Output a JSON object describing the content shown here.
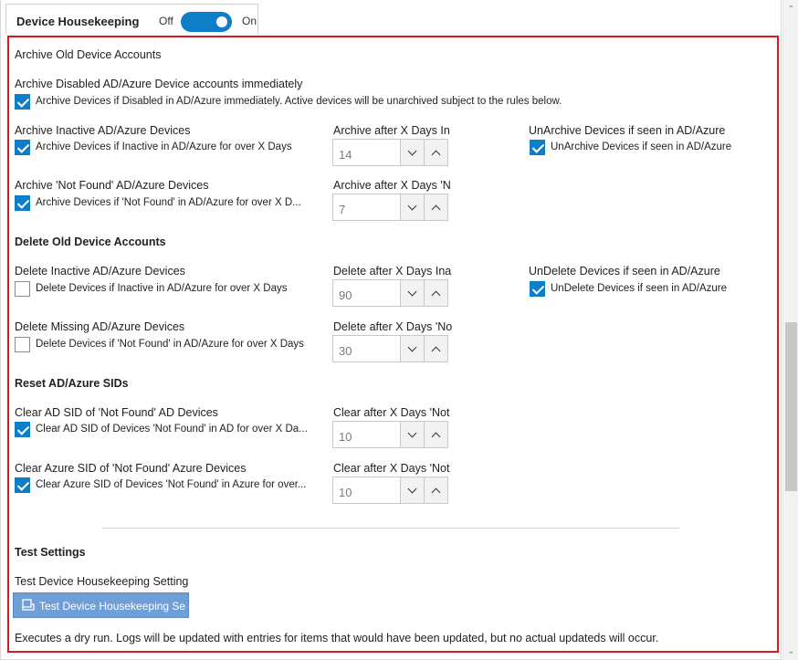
{
  "header": {
    "title": "Device Housekeeping",
    "toggle_off": "Off",
    "toggle_on": "On"
  },
  "archive": {
    "title": "Archive Old Device Accounts",
    "disabled": {
      "label": "Archive Disabled AD/Azure Device accounts immediately",
      "checkbox": "Archive Devices if Disabled in AD/Azure immediately. Active devices will be unarchived subject to the rules below.",
      "checked": true
    },
    "inactive": {
      "label": "Archive Inactive AD/Azure Devices",
      "checkbox": "Archive Devices if Inactive in AD/Azure for over X Days",
      "checked": true,
      "days_label": "Archive after X Days In",
      "days": "14"
    },
    "unarchive": {
      "label": "UnArchive Devices if seen in AD/Azure",
      "checkbox": "UnArchive Devices if seen in AD/Azure",
      "checked": true
    },
    "not_found": {
      "label": "Archive 'Not Found' AD/Azure Devices",
      "checkbox": "Archive Devices if 'Not Found' in AD/Azure for over X D...",
      "checked": true,
      "days_label": "Archive after X Days 'N",
      "days": "7"
    }
  },
  "delete": {
    "title": "Delete Old Device Accounts",
    "inactive": {
      "label": "Delete Inactive AD/Azure Devices",
      "checkbox": "Delete Devices if Inactive in AD/Azure for over X Days",
      "checked": false,
      "days_label": "Delete after X Days Ina",
      "days": "90"
    },
    "undelete": {
      "label": "UnDelete Devices if seen in AD/Azure",
      "checkbox": "UnDelete Devices if seen in AD/Azure",
      "checked": true
    },
    "missing": {
      "label": "Delete Missing AD/Azure Devices",
      "checkbox": "Delete Devices if 'Not Found' in AD/Azure for over X Days",
      "checked": false,
      "days_label": "Delete after X Days 'No",
      "days": "30"
    }
  },
  "reset": {
    "title": "Reset AD/Azure SIDs",
    "ad": {
      "label": "Clear AD SID of 'Not Found' AD Devices",
      "checkbox": "Clear AD SID of Devices 'Not Found' in AD for over X Da...",
      "checked": true,
      "days_label": "Clear after X Days 'Not",
      "days": "10"
    },
    "azure": {
      "label": "Clear Azure SID of 'Not Found' Azure Devices",
      "checkbox": "Clear Azure SID of Devices 'Not Found' in Azure for over...",
      "checked": true,
      "days_label": "Clear after X Days 'Not",
      "days": "10"
    }
  },
  "test": {
    "title": "Test Settings",
    "label": "Test Device Housekeeping Setting",
    "button": "Test Device Housekeeping Se",
    "note": "Executes a dry run. Logs will be updated with entries for items that would have been updated, but no actual updateds will occur."
  },
  "icons": {
    "toggle": "toggle-switch",
    "check": "check-icon",
    "chevron_up": "chevron-up-icon",
    "chevron_down": "chevron-down-icon",
    "test": "test-run-icon"
  },
  "colors": {
    "accent": "#0e7ec9",
    "panel_border": "#d8191f",
    "button_bg": "#6f9fd6"
  }
}
